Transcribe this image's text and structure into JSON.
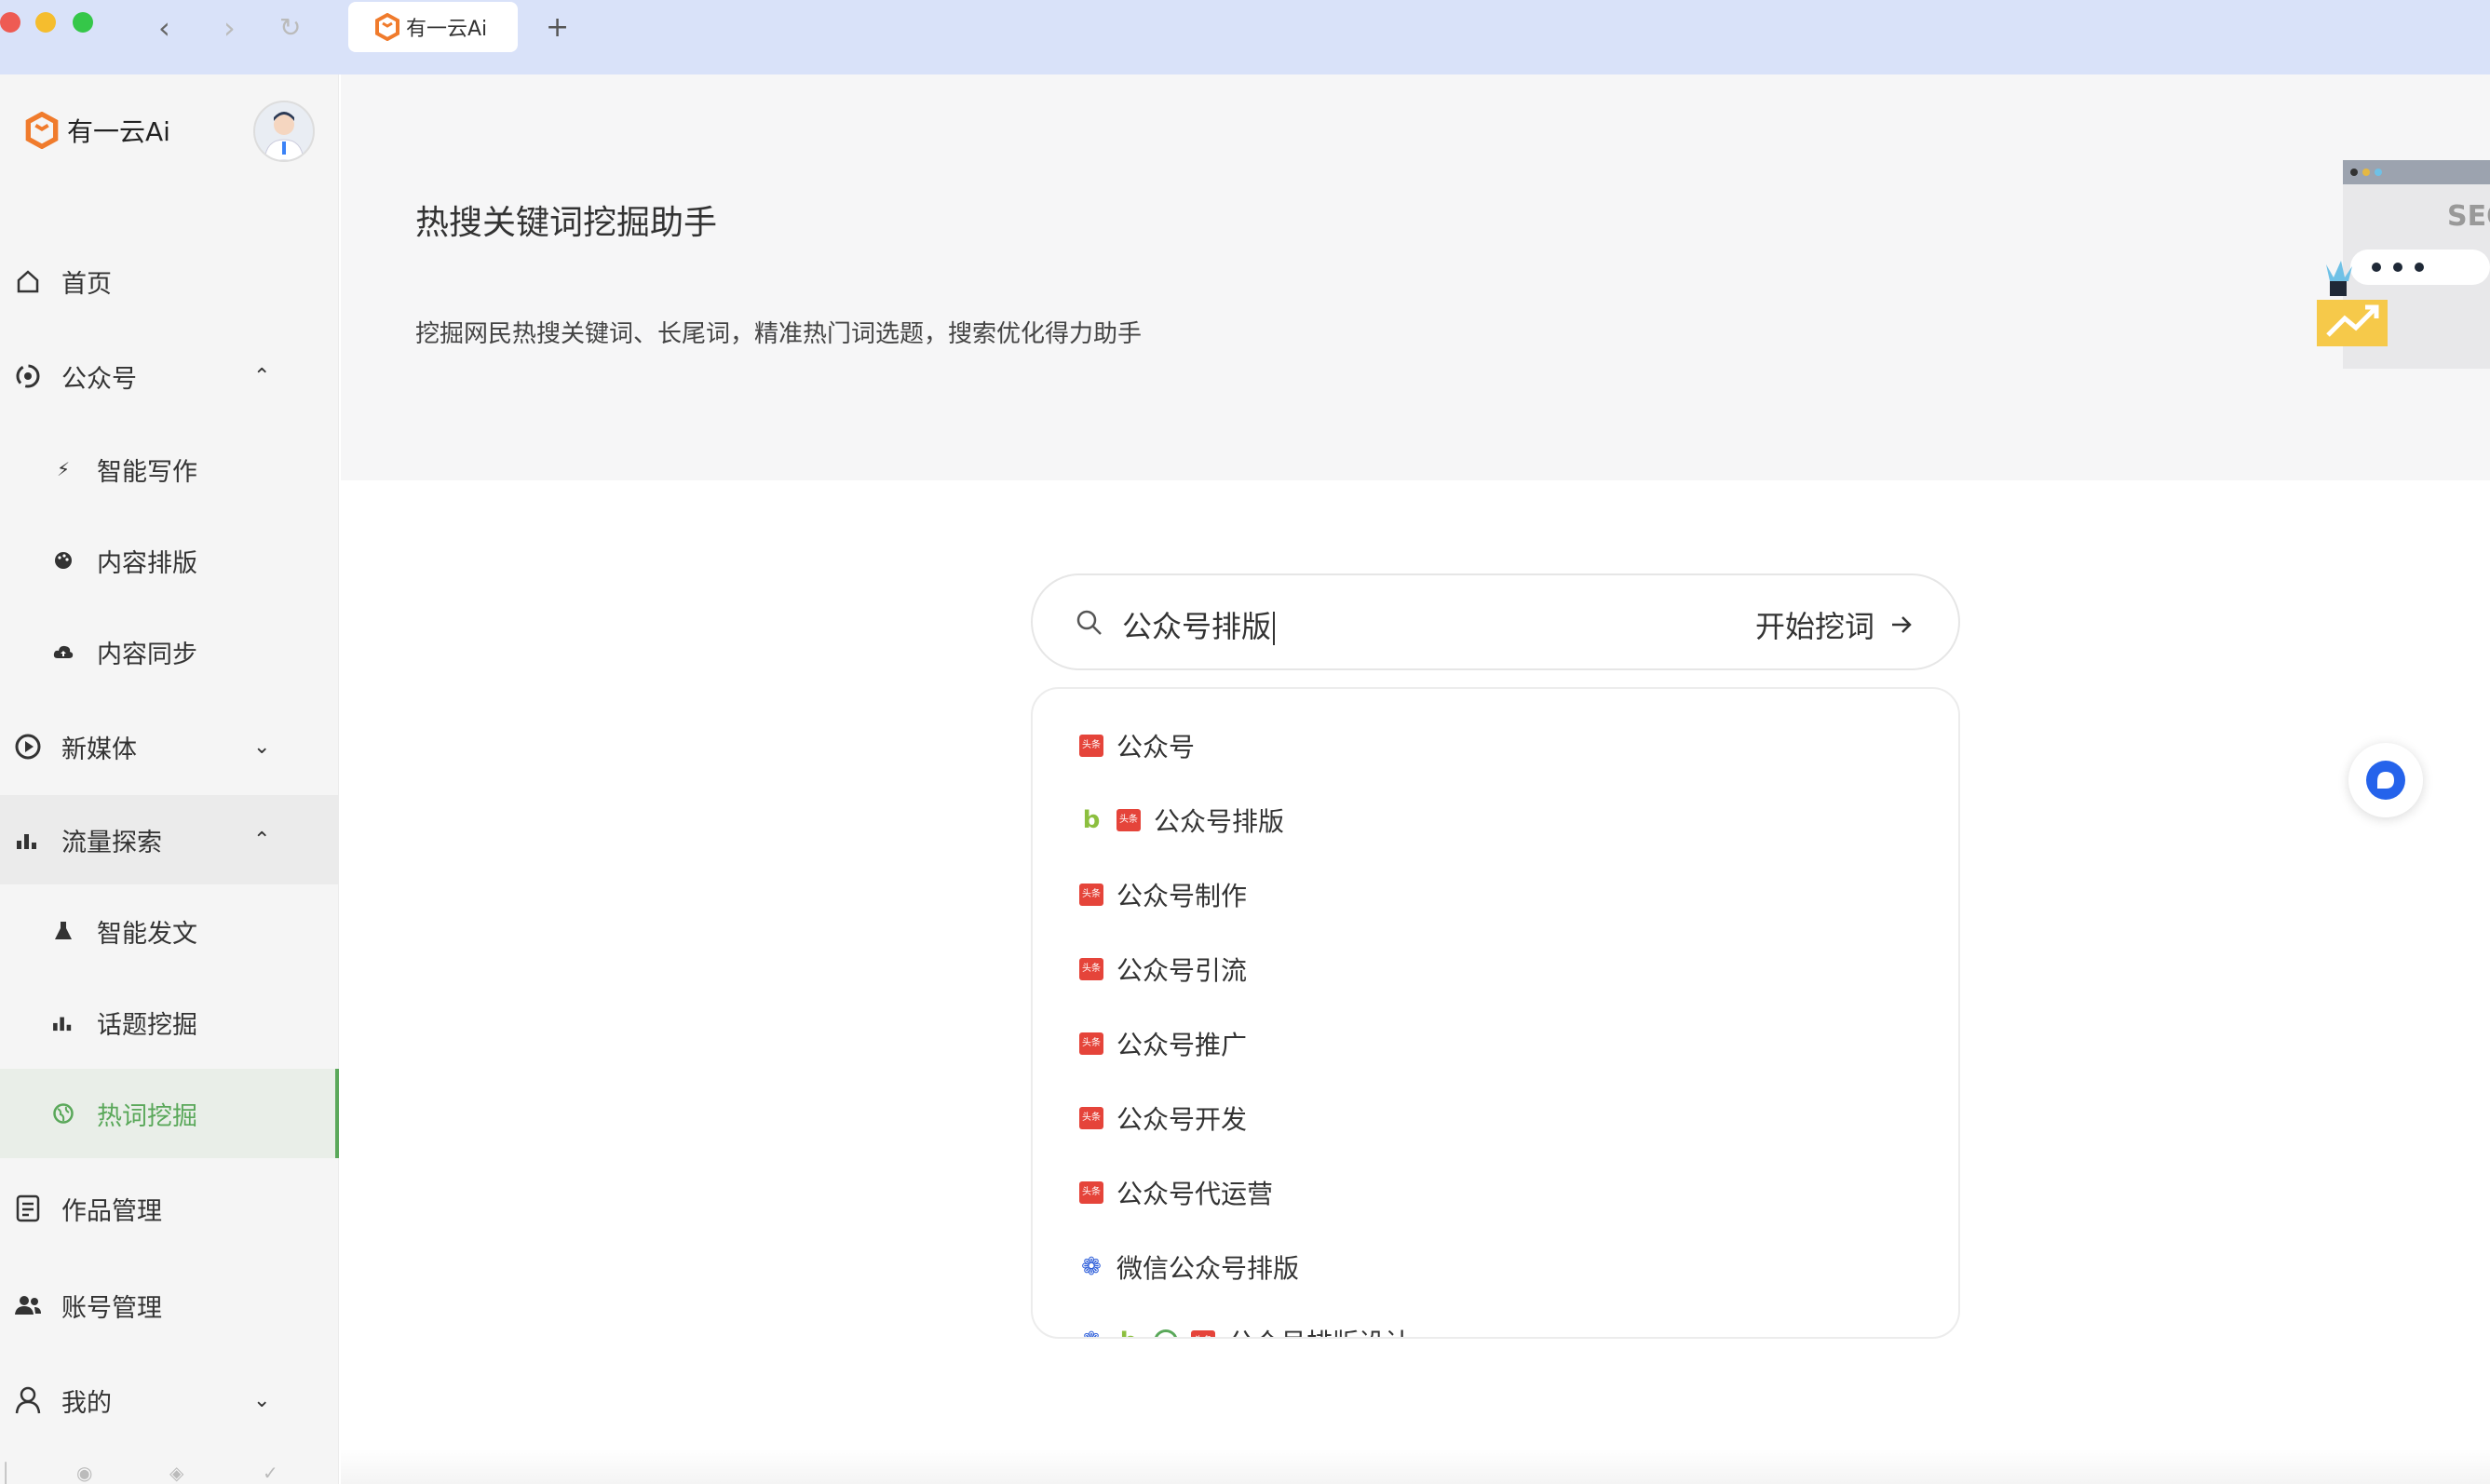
{
  "browser": {
    "tab_title": "有一云Ai",
    "new_tab": "+"
  },
  "sidebar": {
    "brand": "有一云Ai",
    "items": [
      {
        "label": "首页",
        "icon": "home-icon"
      },
      {
        "label": "公众号",
        "icon": "wechat-official-icon",
        "expanded": true
      },
      {
        "label": "智能写作",
        "icon": "lightning-icon"
      },
      {
        "label": "内容排版",
        "icon": "palette-icon"
      },
      {
        "label": "内容同步",
        "icon": "cloud-upload-icon"
      },
      {
        "label": "新媒体",
        "icon": "play-circle-icon",
        "expanded": false
      },
      {
        "label": "流量探索",
        "icon": "bar-chart-icon",
        "expanded": true
      },
      {
        "label": "智能发文",
        "icon": "flask-icon"
      },
      {
        "label": "话题挖掘",
        "icon": "bar-chart-icon"
      },
      {
        "label": "热词挖掘",
        "icon": "globe-icon",
        "active": true
      },
      {
        "label": "作品管理",
        "icon": "document-icon"
      },
      {
        "label": "账号管理",
        "icon": "users-icon"
      },
      {
        "label": "我的",
        "icon": "user-icon",
        "expanded": false
      }
    ]
  },
  "hero": {
    "title": "热搜关键词挖掘助手",
    "subtitle": "挖掘网民热搜关键词、长尾词，精准热门词选题，搜索优化得力助手",
    "illustration_text": "SEO"
  },
  "search": {
    "value": "公众号排版",
    "action_label": "开始挖词"
  },
  "suggestions": [
    {
      "text": "公众号",
      "sources": [
        "toutiao"
      ]
    },
    {
      "text": "公众号排版",
      "sources": [
        "bing",
        "toutiao"
      ]
    },
    {
      "text": "公众号制作",
      "sources": [
        "toutiao"
      ]
    },
    {
      "text": "公众号引流",
      "sources": [
        "toutiao"
      ]
    },
    {
      "text": "公众号推广",
      "sources": [
        "toutiao"
      ]
    },
    {
      "text": "公众号开发",
      "sources": [
        "toutiao"
      ]
    },
    {
      "text": "公众号代运营",
      "sources": [
        "toutiao"
      ]
    },
    {
      "text": "微信公众号排版",
      "sources": [
        "baidu"
      ]
    },
    {
      "text": "公众号排版设计",
      "sources": [
        "baidu",
        "bing",
        "sougou",
        "toutiao"
      ]
    }
  ],
  "colors": {
    "accent_green": "#5aa85a",
    "brand_orange": "#f07b2c",
    "titlebar": "#d9e2f9",
    "toutiao_red": "#e5443a",
    "float_blue": "#2563eb"
  }
}
